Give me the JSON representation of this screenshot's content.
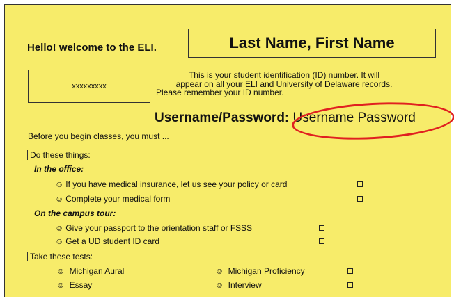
{
  "greeting": "Hello! welcome to the ELI.",
  "name_placeholder": "Last Name, First Name",
  "student_id": "xxxxxxxxx",
  "id_note_line1": "This is your student identification (ID) number. It will",
  "id_note_line2": "appear on all your ELI and University of Delaware records.",
  "id_note_line3": "Please remember your ID number.",
  "credentials_label": "Username/Password:",
  "credentials_value": "Username Password",
  "intro": "Before you begin classes, you must ...",
  "section_things": "Do these things:",
  "office_heading": "In the office:",
  "office_items": [
    "If you have medical insurance, let us see your policy or card",
    "Complete your medical form"
  ],
  "tour_heading": "On the campus tour:",
  "tour_items": [
    "Give your passport to the orientation staff or FSSS",
    "Get a UD student ID card"
  ],
  "section_tests": "Take these tests:",
  "tests": [
    "Michigan Aural",
    "Michigan Proficiency",
    "Essay",
    "Interview"
  ],
  "smiley_glyph": "☺",
  "colors": {
    "background": "#f7ec6a",
    "highlight_oval": "#e02020"
  }
}
